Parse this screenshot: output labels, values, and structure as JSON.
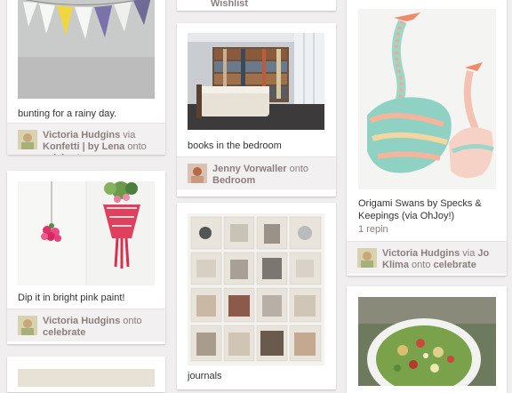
{
  "pins": [
    {
      "description": "bunting for a rainy day.",
      "user": "Victoria Hudgins",
      "via_word": "via",
      "via_user": "Konfetti | by Lena",
      "onto_word": "onto",
      "board": "celebrate"
    },
    {
      "description": "Dip it in bright pink paint!",
      "user": "Victoria Hudgins",
      "onto_word": "onto",
      "board": "celebrate"
    },
    {
      "top_text": "Wishlist",
      "description": "books in the bedroom",
      "user": "Jenny Vorwaller",
      "onto_word": "onto",
      "board": "Bedroom"
    },
    {
      "description": "journals"
    },
    {
      "description": "Origami Swans by Specks & Keepings (via OhJoy!)",
      "repins": "1 repin",
      "user": "Victoria Hudgins",
      "via_word": "via",
      "via_user": "Jo Klima",
      "onto_word": "onto",
      "board": "celebrate"
    }
  ],
  "colors": {
    "background": "#f0eeee",
    "card": "#ffffff",
    "footer": "#f2f0f0",
    "meta_text": "#8c7e7e"
  }
}
